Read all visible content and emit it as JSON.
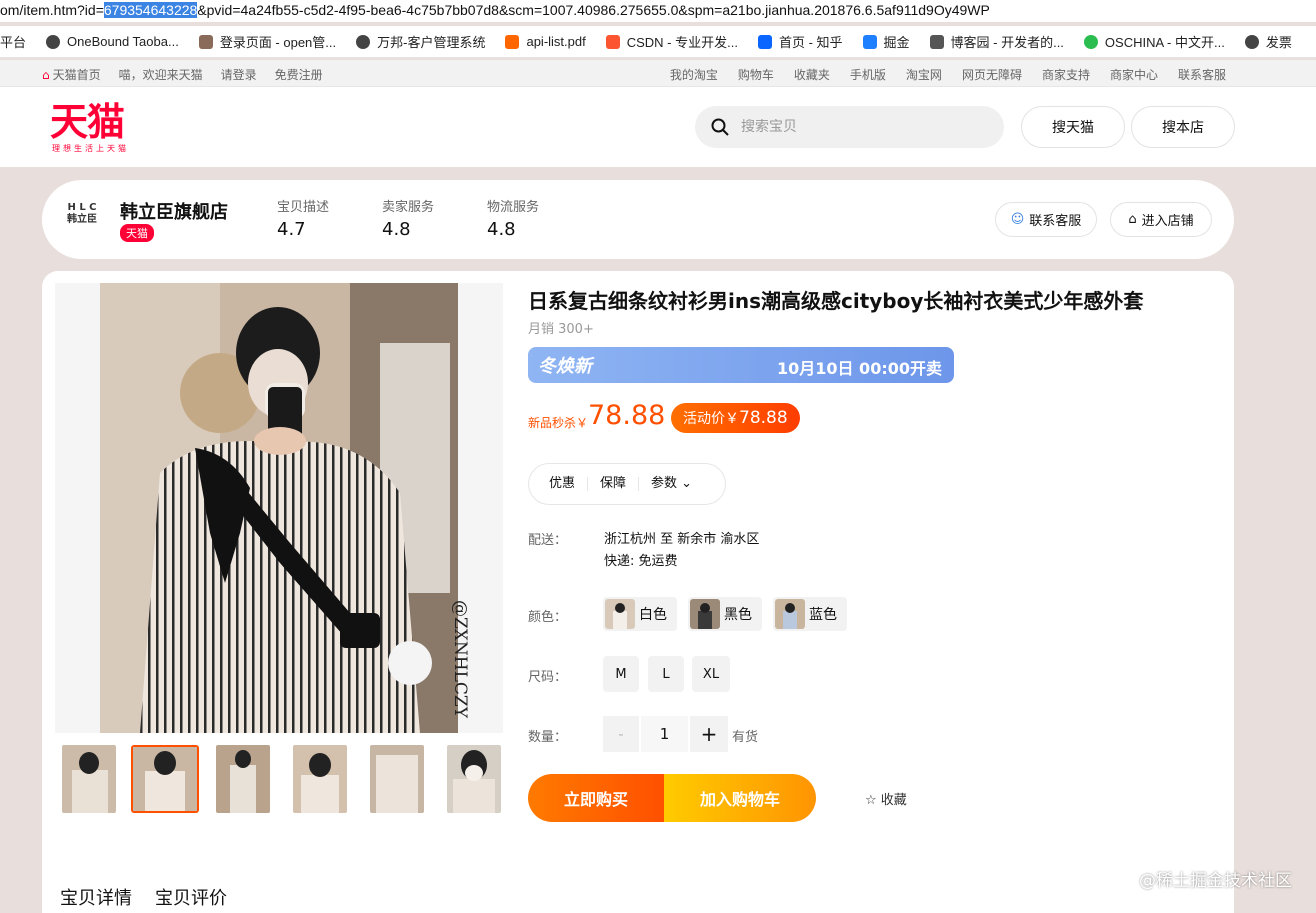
{
  "browser": {
    "url_prefix": "om/item.htm?id=",
    "url_id": "679354643228",
    "url_rest": "&pvid=4a24fb55-c5d2-4f95-bea6-4c75b7bb07d8&scm=1007.40986.275655.0&spm=a21bo.jianhua.201876.6.5af911d9Oy49WP",
    "bookmarks": [
      "平台",
      "OneBound Taoba...",
      "登录页面 - open管...",
      "万邦-客户管理系统",
      "api-list.pdf",
      "CSDN - 专业开发...",
      "首页 - 知乎",
      "掘金",
      "博客园 - 开发者的...",
      "OSCHINA - 中文开...",
      "发票"
    ]
  },
  "topnav": {
    "left": [
      "天猫首页",
      "喵，欢迎来天猫",
      "请登录",
      "免费注册"
    ],
    "right": [
      "我的淘宝",
      "购物车",
      "收藏夹",
      "手机版",
      "淘宝网",
      "网页无障碍",
      "商家支持",
      "商家中心",
      "联系客服"
    ]
  },
  "header": {
    "logo": "天猫",
    "slogan": "理想生活上天猫",
    "search_placeholder": "搜索宝贝",
    "btn_tmall": "搜天猫",
    "btn_shop": "搜本店"
  },
  "shop": {
    "logo_text": "H L C 韩立臣",
    "name": "韩立臣旗舰店",
    "tag": "天猫",
    "scores": [
      {
        "label": "宝贝描述",
        "value": "4.7"
      },
      {
        "label": "卖家服务",
        "value": "4.8"
      },
      {
        "label": "物流服务",
        "value": "4.8"
      }
    ],
    "btn_service": "联系客服",
    "btn_enter": "进入店铺"
  },
  "product": {
    "title": "日系复古细条纹衬衫男ins潮高级感cityboy长袖衬衣美式少年感外套",
    "sales": "月销 300+",
    "promo_left": "冬焕新",
    "promo_right": "10月10日 00:00开卖",
    "price_label": "新品秒杀￥",
    "price": "78.88",
    "act_label": "活动价￥",
    "act_price": "78.88",
    "tabs": [
      "优惠",
      "保障",
      "参数 ⌄"
    ],
    "ship_label": "配送：",
    "ship_route": "浙江杭州 至 新余市 渝水区",
    "ship_fee": "快递: 免运费",
    "color_label": "颜色：",
    "colors": [
      "白色",
      "黑色",
      "蓝色"
    ],
    "size_label": "尺码：",
    "sizes": [
      "M",
      "L",
      "XL"
    ],
    "qty_label": "数量：",
    "qty_minus": "-",
    "qty_value": "1",
    "qty_plus": "+",
    "stock": "有货",
    "buy": "立即购买",
    "cart": "加入购物车",
    "fav": "☆ 收藏",
    "watermark": "@ZXNHLCZY"
  },
  "detail_tabs": [
    "宝贝详情",
    "宝贝评价"
  ],
  "site_watermark": "@稀土掘金技术社区"
}
